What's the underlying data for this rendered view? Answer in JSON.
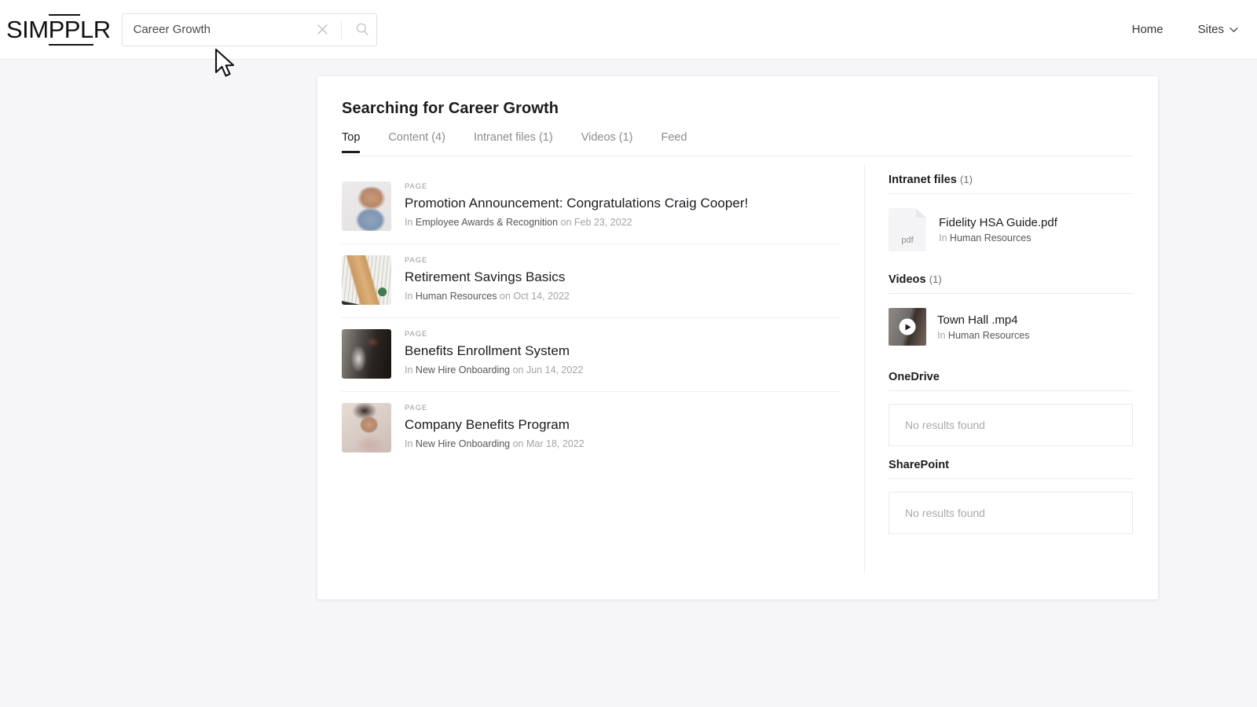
{
  "header": {
    "logo_segments": [
      {
        "text": "SIM",
        "over": false,
        "under": false
      },
      {
        "text": "PP",
        "over": true,
        "under": true
      },
      {
        "text": "L",
        "over": false,
        "under": true
      },
      {
        "text": "R",
        "over": false,
        "under": false
      }
    ],
    "logo_text": "SIMPPLR",
    "search": {
      "value": "Career Growth",
      "placeholder": "Search",
      "clear_icon": "close-icon",
      "search_icon": "search-icon"
    },
    "nav": [
      {
        "label": "Home",
        "has_chevron": false
      },
      {
        "label": "Sites",
        "has_chevron": true
      }
    ]
  },
  "main": {
    "title": "Searching for Career Growth",
    "tabs": [
      {
        "label": "Top",
        "active": true
      },
      {
        "label": "Content (4)",
        "active": false
      },
      {
        "label": "Intranet files (1)",
        "active": false
      },
      {
        "label": "Videos (1)",
        "active": false
      },
      {
        "label": "Feed",
        "active": false
      }
    ],
    "results": [
      {
        "kind": "PAGE",
        "title": "Promotion Announcement: Congratulations Craig Cooper!",
        "meta_in": "In",
        "site": "Employee Awards & Recognition",
        "meta_on": "on",
        "date": "Feb 23, 2022",
        "thumb": "portrait-man-blue-shirt"
      },
      {
        "kind": "PAGE",
        "title": "Retirement Savings Basics",
        "meta_in": "In",
        "site": "Human Resources",
        "meta_on": "on",
        "date": "Oct 14, 2022",
        "thumb": "scrabble-tiles-save"
      },
      {
        "kind": "PAGE",
        "title": "Benefits Enrollment System",
        "meta_in": "In",
        "site": "New Hire Onboarding",
        "meta_on": "on",
        "date": "Jun 14, 2022",
        "thumb": "desk-writing-dark"
      },
      {
        "kind": "PAGE",
        "title": "Company Benefits Program",
        "meta_in": "In",
        "site": "New Hire Onboarding",
        "meta_on": "on",
        "date": "Mar 18, 2022",
        "thumb": "woman-on-phone"
      }
    ]
  },
  "sidebar": {
    "intranet_files": {
      "heading": "Intranet files",
      "count": "(1)",
      "item": {
        "icon_label": "pdf",
        "title": "Fidelity HSA Guide.pdf",
        "meta_in": "In",
        "site": "Human Resources"
      }
    },
    "videos": {
      "heading": "Videos",
      "count": "(1)",
      "item": {
        "title": "Town Hall .mp4",
        "meta_in": "In",
        "site": "Human Resources"
      }
    },
    "onedrive": {
      "heading": "OneDrive",
      "empty": "No results found"
    },
    "sharepoint": {
      "heading": "SharePoint",
      "empty": "No results found"
    }
  },
  "colors": {
    "page_bg": "#f6f5f8",
    "card_bg": "#ffffff",
    "text_primary": "#1b1b20",
    "text_muted": "#a3a3ab",
    "accent_underline": "#1b1b20"
  }
}
